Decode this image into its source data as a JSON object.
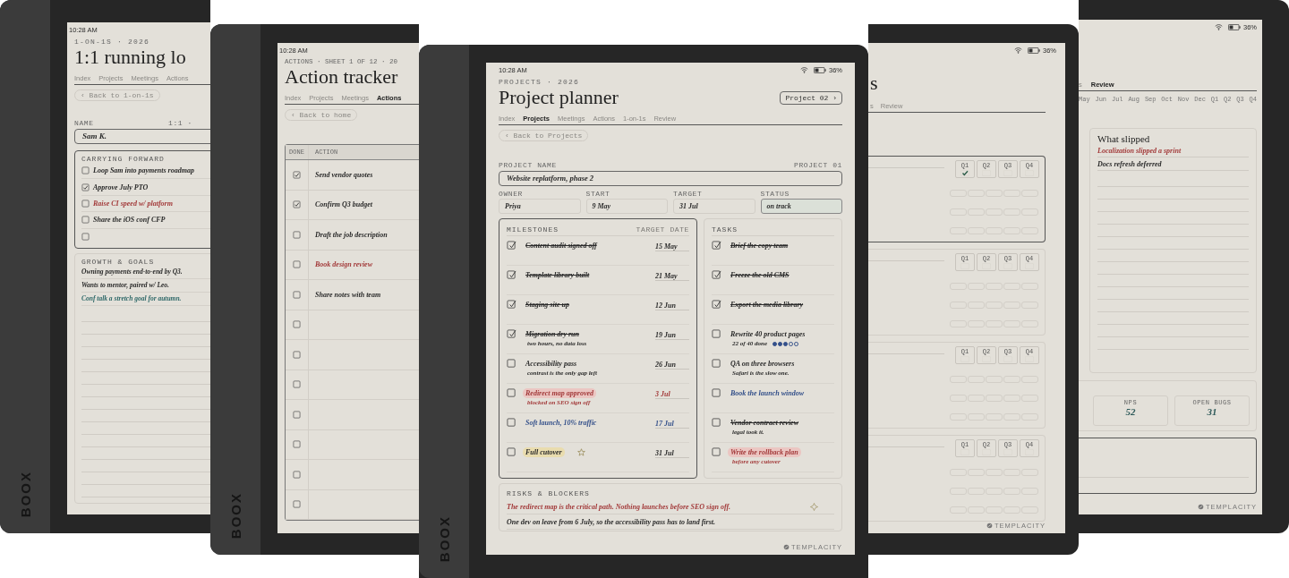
{
  "left_device": {
    "brand": "BOOX",
    "time": "10:28 AM",
    "eyebrow": "1-ON-1S · 2026",
    "title": "1:1 running lo",
    "tabs": [
      {
        "label": "Index",
        "selected": false
      },
      {
        "label": "Projects",
        "selected": false
      },
      {
        "label": "Meetings",
        "selected": false
      },
      {
        "label": "Actions",
        "selected": false
      }
    ],
    "back": "‹ Back to 1-on-1s",
    "name_label": "NAME",
    "name_meta": "1:1 ·",
    "name_value": "Sam K.",
    "carrying": {
      "title": "CARRYING FORWARD",
      "items": [
        {
          "text": "Loop Sam into payments roadmap",
          "checked": false,
          "color": "#2b2b2b"
        },
        {
          "text": "Approve July PTO",
          "checked": true,
          "color": "#2b2b2b"
        },
        {
          "text": "Raise CI speed w/ platform",
          "checked": false,
          "color": "#a33b3b"
        },
        {
          "text": "Share the iOS conf CFP",
          "checked": false,
          "color": "#2b2b2b"
        },
        {
          "checked": false
        }
      ]
    },
    "growth": {
      "title": "GROWTH & GOALS",
      "lines": [
        {
          "text": "Owning payments end-to-end by Q3.",
          "color": "#2b2b2b"
        },
        {
          "text": "Wants to mentor, paired w/ Leo.",
          "color": "#2b2b2b"
        },
        {
          "text": "Conf talk a stretch goal for autumn.",
          "color": "#2e6868"
        }
      ]
    }
  },
  "actions_device": {
    "brand": "BOOX",
    "time": "10:28 AM",
    "eyebrow": "ACTIONS · SHEET 1 OF 12 · 20",
    "title": "Action tracker",
    "tabs": [
      {
        "label": "Index",
        "selected": false
      },
      {
        "label": "Projects",
        "selected": false
      },
      {
        "label": "Meetings",
        "selected": false
      },
      {
        "label": "Actions",
        "selected": true
      }
    ],
    "back": "‹ Back to home",
    "columns": [
      "DONE",
      "ACTION"
    ],
    "rows": [
      {
        "text": "Send vendor quotes",
        "checked": true,
        "color": "#2b2b2b"
      },
      {
        "text": "Confirm Q3 budget",
        "checked": true,
        "color": "#2b2b2b"
      },
      {
        "text": "Draft the job description",
        "checked": false,
        "color": "#2b2b2b"
      },
      {
        "text": "Book design review",
        "checked": false,
        "color": "#a33b3b"
      },
      {
        "text": "Share notes with team",
        "checked": false,
        "color": "#2b2b2b"
      },
      {
        "checked": false
      },
      {
        "checked": false
      },
      {
        "checked": false
      },
      {
        "checked": false
      },
      {
        "checked": false
      },
      {
        "checked": false
      },
      {
        "checked": false
      }
    ]
  },
  "planner_device": {
    "brand": "BOOX",
    "time": "10:28 AM",
    "battery": "36%",
    "eyebrow": "PROJECTS · 2026",
    "title": "Project planner",
    "project_switch": "Project 02 ›",
    "tabs": [
      {
        "label": "Index",
        "selected": false
      },
      {
        "label": "Projects",
        "selected": true
      },
      {
        "label": "Meetings",
        "selected": false
      },
      {
        "label": "Actions",
        "selected": false
      },
      {
        "label": "1-on-1s",
        "selected": false
      },
      {
        "label": "Review",
        "selected": false
      }
    ],
    "back": "‹ Back to Projects",
    "name_label": "PROJECT NAME",
    "name_meta": "PROJECT 01",
    "name_value": "Website replatform, phase 2",
    "fields": [
      {
        "label": "OWNER",
        "value": "Priya",
        "selected": false
      },
      {
        "label": "START",
        "value": "9 May",
        "selected": false
      },
      {
        "label": "TARGET",
        "value": "31 Jul",
        "selected": false
      },
      {
        "label": "STATUS",
        "value": "on track",
        "selected": true
      }
    ],
    "milestones": {
      "title": "MILESTONES",
      "date_heading": "TARGET DATE",
      "items": [
        {
          "text": "Content audit signed off",
          "date": "15 May",
          "checked": true,
          "color": "#2b2b2b"
        },
        {
          "text": "Template library built",
          "date": "21 May",
          "checked": true,
          "color": "#2b2b2b"
        },
        {
          "text": "Staging site up",
          "date": "12 Jun",
          "checked": true,
          "color": "#2b2b2b"
        },
        {
          "text": "Migration dry run",
          "note": "two hours, no data loss",
          "date": "19 Jun",
          "checked": true,
          "color": "#2b2b2b"
        },
        {
          "text": "Accessibility pass",
          "note": "contrast is the only gap left",
          "date": "26 Jun",
          "checked": false,
          "color": "#2b2b2b"
        },
        {
          "text": "Redirect map approved",
          "note": "blocked on SEO sign off",
          "date": "3 Jul",
          "checked": false,
          "color": "#a33b3b",
          "highlight": true
        },
        {
          "text": "Soft launch, 10% traffic",
          "date": "17 Jul",
          "checked": false,
          "color": "#34508a"
        },
        {
          "text": "Full cutover",
          "date": "31 Jul",
          "checked": false,
          "color": "#2b2b2b",
          "highlight": true,
          "starred": true
        }
      ]
    },
    "tasks": {
      "title": "TASKS",
      "items": [
        {
          "text": "Brief the copy team",
          "checked": true,
          "struck": true,
          "color": "#2b2b2b"
        },
        {
          "text": "Freeze the old CMS",
          "checked": true,
          "struck": true,
          "color": "#2b2b2b"
        },
        {
          "text": "Export the media library",
          "checked": true,
          "struck": true,
          "color": "#2b2b2b"
        },
        {
          "text": "Rewrite 40 product pages",
          "note": "22 of 40 done",
          "stars": 3,
          "checked": false,
          "struck": false,
          "color": "#2b2b2b"
        },
        {
          "text": "QA on three browsers",
          "note": "Safari is the slow one.",
          "checked": false,
          "struck": false,
          "color": "#2b2b2b"
        },
        {
          "text": "Book the launch window",
          "checked": false,
          "struck": false,
          "color": "#34508a"
        },
        {
          "text": "Vendor contract review",
          "note": "legal took it.",
          "checked": false,
          "struck": true,
          "color": "#2b2b2b"
        },
        {
          "text": "Write the rollback plan",
          "note": "before any cutover",
          "checked": false,
          "struck": false,
          "color": "#a33b3b",
          "highlight": true
        }
      ]
    },
    "risks": {
      "title": "RISKS & BLOCKERS",
      "lines": [
        {
          "text": "The redirect map is the critical path. Nothing launches before SEO sign off.",
          "color": "#a33b3b"
        },
        {
          "text": "One dev on leave from 6 July, so the accessibility pass has to land first.",
          "color": "#2b2b2b"
        }
      ]
    },
    "footer": "TEMPLACITY"
  },
  "quarters_device": {
    "battery": "36%",
    "title": "s",
    "tabs": [
      {
        "label": "s",
        "selected": false
      },
      {
        "label": "Review",
        "selected": false
      }
    ],
    "cards": [
      {
        "selected": true,
        "quarters": [
          {
            "label": "Q1",
            "checked": true
          },
          {
            "label": "Q2",
            "checked": false
          },
          {
            "label": "Q3",
            "checked": false
          },
          {
            "label": "Q4",
            "checked": false
          }
        ]
      },
      {
        "selected": false,
        "quarters": [
          {
            "label": "Q1",
            "checked": false
          },
          {
            "label": "Q2",
            "checked": false
          },
          {
            "label": "Q3",
            "checked": false
          },
          {
            "label": "Q4",
            "checked": false
          }
        ]
      },
      {
        "selected": false,
        "quarters": [
          {
            "label": "Q1",
            "checked": false
          },
          {
            "label": "Q2",
            "checked": false
          },
          {
            "label": "Q3",
            "checked": false
          },
          {
            "label": "Q4",
            "checked": false
          }
        ]
      },
      {
        "selected": false,
        "quarters": [
          {
            "label": "Q1",
            "checked": false
          },
          {
            "label": "Q2",
            "checked": false
          },
          {
            "label": "Q3",
            "checked": false
          },
          {
            "label": "Q4",
            "checked": false
          }
        ]
      }
    ],
    "footer": "TEMPLACITY"
  },
  "review_device": {
    "battery": "36%",
    "tabs": [
      {
        "label": "s",
        "selected": false
      },
      {
        "label": "Review",
        "selected": true
      }
    ],
    "months": [
      "May",
      "Jun",
      "Jul",
      "Aug",
      "Sep",
      "Oct",
      "Nov",
      "Dec",
      "Q1",
      "Q2",
      "Q3",
      "Q4"
    ],
    "slipped": {
      "title": "What slipped",
      "lines": [
        {
          "text": "Localization slipped a sprint",
          "color": "#a33b3b"
        },
        {
          "text": "Docs refresh deferred",
          "color": "#2b2b2b"
        }
      ]
    },
    "stats": [
      {
        "label": "NPS",
        "value": "52"
      },
      {
        "label": "OPEN BUGS",
        "value": "31"
      }
    ],
    "footer": "TEMPLACITY"
  }
}
